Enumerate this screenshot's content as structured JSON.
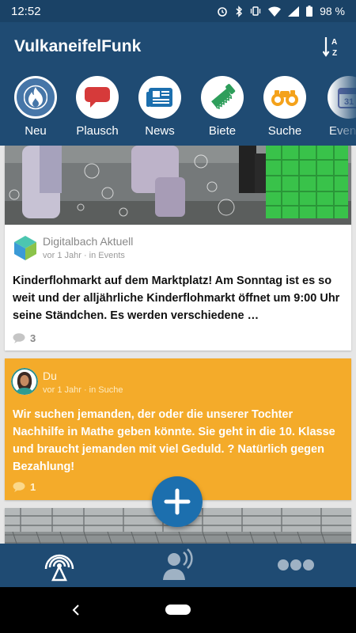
{
  "status": {
    "time": "12:52",
    "battery": "98 %"
  },
  "app": {
    "title": "VulkaneifelFunk"
  },
  "categories": [
    {
      "label": "Neu",
      "icon": "fire-icon"
    },
    {
      "label": "Plausch",
      "icon": "chat-bubble-icon"
    },
    {
      "label": "News",
      "icon": "newspaper-icon"
    },
    {
      "label": "Biete",
      "icon": "saw-icon"
    },
    {
      "label": "Suche",
      "icon": "binoculars-icon"
    },
    {
      "label": "Even",
      "icon": "calendar-icon"
    }
  ],
  "calendar_day": "31",
  "posts": [
    {
      "author": "Digitalbach Aktuell",
      "meta": "vor 1 Jahr · in Events",
      "text": "Kinderflohmarkt auf dem Marktplatz! Am Sonntag ist es so weit und der alljährliche Kinderflohmarkt öffnet um 9:00 Uhr seine Ständchen. Es werden verschiedene …",
      "comments": "3"
    },
    {
      "author": "Du",
      "meta": "vor 1 Jahr · in Suche",
      "text": "Wir suchen jemanden, der oder die unserer Tochter Nachhilfe in Mathe geben könnte. Sie geht in die 10. Klasse und braucht jemanden mit viel Geduld. ? Natürlich gegen Bezahlung!",
      "comments": "1"
    }
  ],
  "colors": {
    "primary": "#1f4b73",
    "accent": "#1c6fae",
    "highlight_card": "#f4ab2a"
  }
}
